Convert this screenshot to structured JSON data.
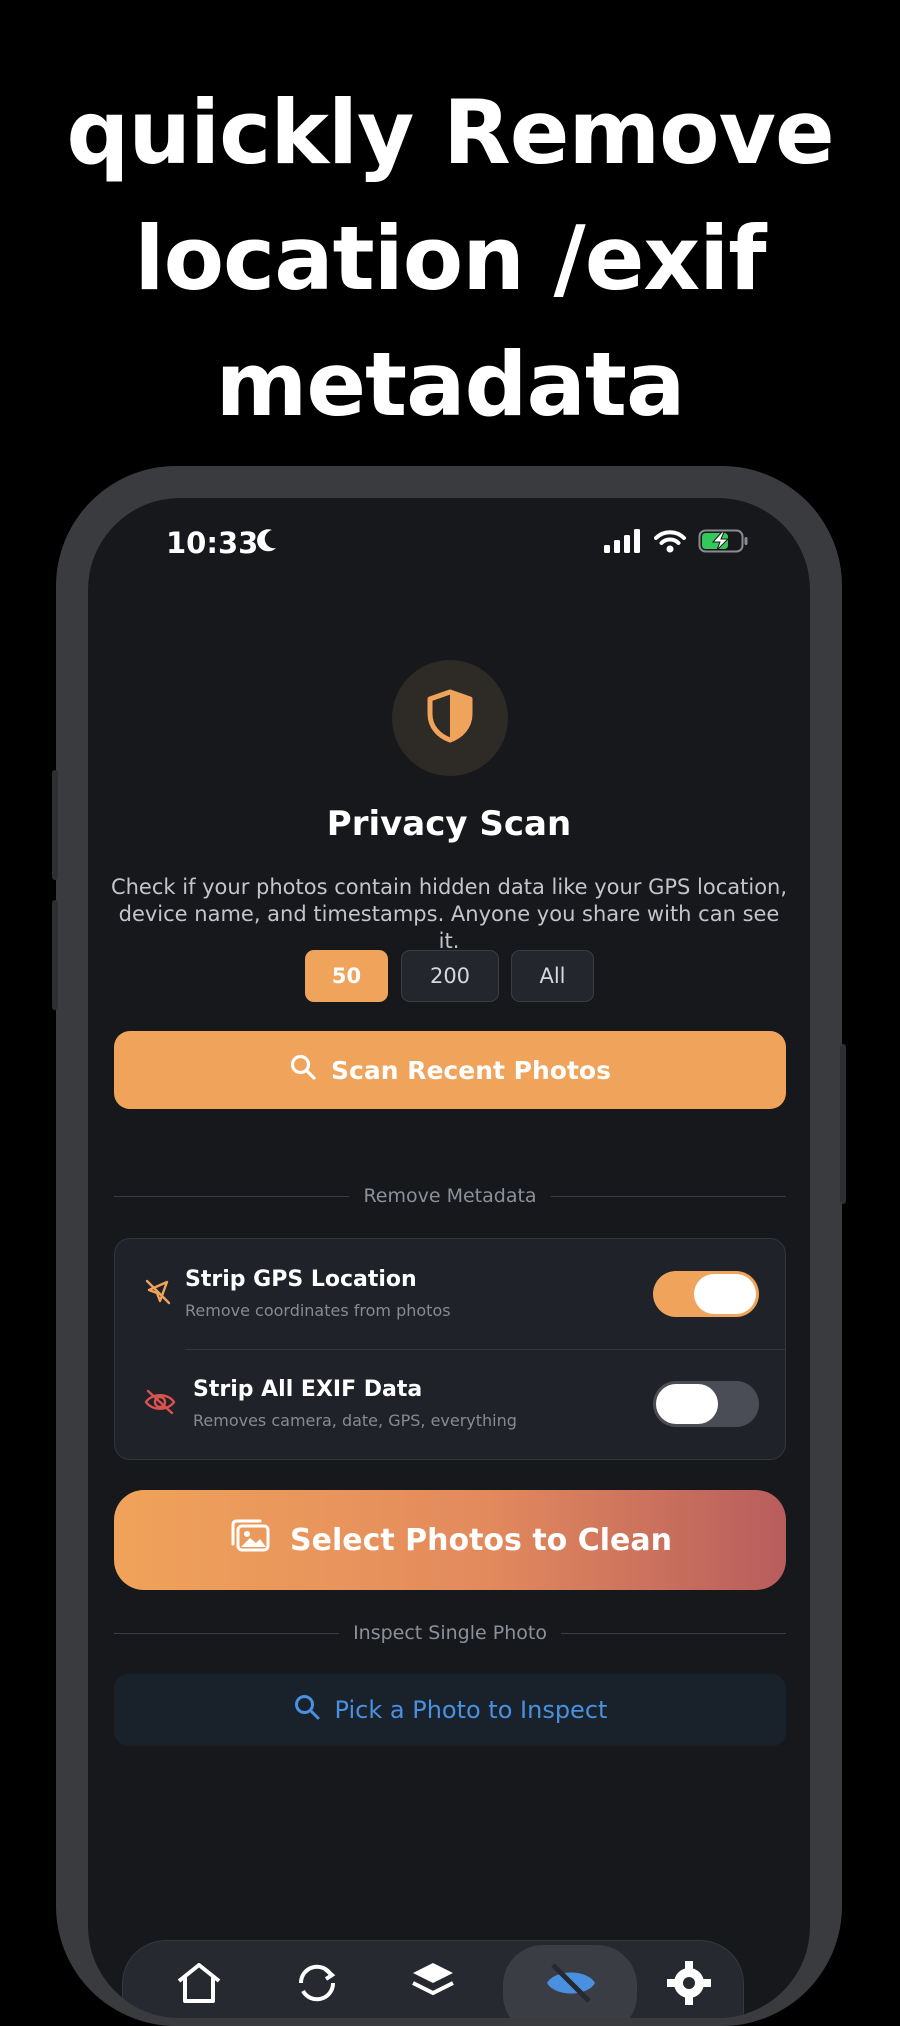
{
  "headline": {
    "lines": [
      "quickly Remove",
      "location /exif",
      "metadata"
    ]
  },
  "status_bar": {
    "time": "10:33",
    "icons": [
      "moon-icon",
      "signal-icon",
      "wifi-icon",
      "battery-charging-icon"
    ]
  },
  "scan": {
    "icon": "shield-icon",
    "title": "Privacy Scan",
    "description": "Check if your photos contain hidden data like your GPS location, device name, and timestamps. Anyone you share with can see it.",
    "counts": [
      "50",
      "200",
      "All"
    ],
    "selected_count": "50",
    "button_label": "Scan Recent Photos"
  },
  "remove": {
    "section_label": "Remove Metadata",
    "options": [
      {
        "title": "Strip GPS Location",
        "subtitle": "Remove coordinates from photos",
        "icon": "location-slash-icon",
        "enabled": true
      },
      {
        "title": "Strip All EXIF Data",
        "subtitle": "Removes camera, date, GPS, everything",
        "icon": "eye-slash-icon",
        "enabled": false
      }
    ],
    "button_label": "Select Photos to Clean"
  },
  "inspect": {
    "section_label": "Inspect Single Photo",
    "button_label": "Pick a Photo to Inspect"
  },
  "tabs": [
    "home-icon",
    "sync-icon",
    "layers-icon",
    "privacy-icon",
    "gear-icon"
  ],
  "active_tab": "privacy-icon",
  "colors": {
    "accent": "#f0a35a",
    "link": "#4a90e0",
    "background": "#16181c"
  }
}
